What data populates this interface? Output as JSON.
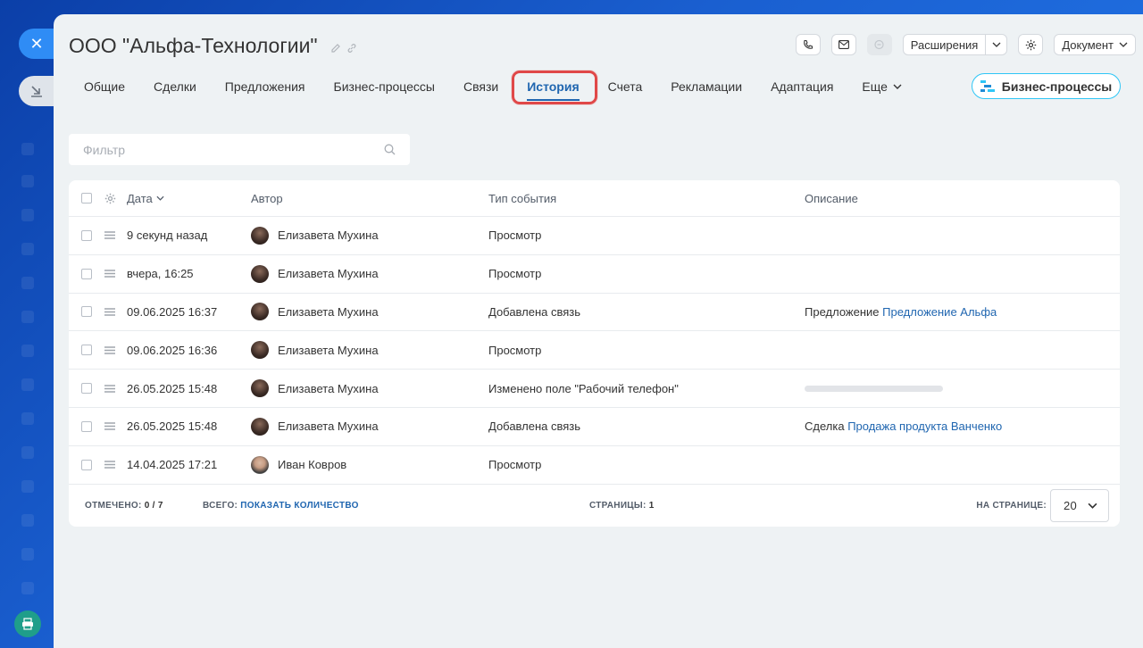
{
  "entity": {
    "title": "ООО \"Альфа-Технологии\""
  },
  "header": {
    "extensions_label": "Расширения",
    "document_label": "Документ"
  },
  "tabs": [
    {
      "label": "Общие"
    },
    {
      "label": "Сделки"
    },
    {
      "label": "Предложения"
    },
    {
      "label": "Бизнес-процессы"
    },
    {
      "label": "Связи"
    },
    {
      "label": "История",
      "active": true
    },
    {
      "label": "Счета"
    },
    {
      "label": "Рекламации"
    },
    {
      "label": "Адаптация"
    },
    {
      "label": "Еще"
    }
  ],
  "bp_button": {
    "label": "Бизнес-процессы"
  },
  "filter": {
    "placeholder": "Фильтр"
  },
  "grid": {
    "headers": {
      "date": "Дата",
      "author": "Автор",
      "type": "Тип события",
      "desc": "Описание"
    },
    "rows": [
      {
        "date": "9 секунд назад",
        "author": "Елизавета Мухина",
        "type": "Просмотр",
        "desc_prefix": "",
        "desc_link": ""
      },
      {
        "date": "вчера, 16:25",
        "author": "Елизавета Мухина",
        "type": "Просмотр",
        "desc_prefix": "",
        "desc_link": ""
      },
      {
        "date": "09.06.2025 16:37",
        "author": "Елизавета Мухина",
        "type": "Добавлена связь",
        "desc_prefix": "Предложение",
        "desc_link": "Предложение Альфа"
      },
      {
        "date": "09.06.2025 16:36",
        "author": "Елизавета Мухина",
        "type": "Просмотр",
        "desc_prefix": "",
        "desc_link": ""
      },
      {
        "date": "26.05.2025 15:48",
        "author": "Елизавета Мухина",
        "type": "Изменено поле \"Рабочий телефон\"",
        "desc_prefix": "",
        "desc_link": ""
      },
      {
        "date": "26.05.2025 15:48",
        "author": "Елизавета Мухина",
        "type": "Добавлена связь",
        "desc_prefix": "Сделка",
        "desc_link": "Продажа продукта Ванченко"
      },
      {
        "date": "14.04.2025 17:21",
        "author": "Иван Ковров",
        "type": "Просмотр",
        "desc_prefix": "",
        "desc_link": ""
      }
    ],
    "footer": {
      "selected_label": "Отмечено:",
      "selected_value": "0 / 7",
      "total_label": "Всего:",
      "total_link": "Показать количество",
      "pages_label": "Страницы:",
      "pages_value": "1",
      "per_page_label": "На странице:",
      "per_page_value": "20"
    }
  },
  "colors": {
    "accent": "#2066b0",
    "highlight": "#e04848",
    "bp_border": "#2fc6f6"
  }
}
